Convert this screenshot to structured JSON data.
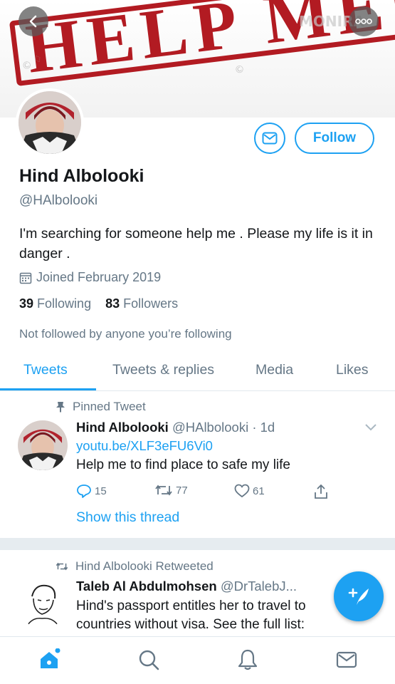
{
  "banner": {
    "stamp_text": "HELP ME!",
    "watermark_brand": "MONIRA"
  },
  "profile": {
    "name": "Hind Albolooki",
    "handle": "@HAlbolooki",
    "bio": "I'm searching for someone help me . Please my life is it in danger .",
    "joined": "Joined February 2019",
    "following_count": "39",
    "following_label": "Following",
    "followers_count": "83",
    "followers_label": "Followers",
    "not_followed": "Not followed by anyone you’re following",
    "follow_label": "Follow"
  },
  "tabs": [
    {
      "label": "Tweets",
      "active": true
    },
    {
      "label": "Tweets & replies",
      "active": false
    },
    {
      "label": "Media",
      "active": false
    },
    {
      "label": "Likes",
      "active": false
    }
  ],
  "pinned_tweet": {
    "pinned_label": "Pinned Tweet",
    "author": "Hind Albolooki",
    "handle_time": "@HAlbolooki · 1d",
    "link": "youtu.be/XLF3eFU6Vi0",
    "text": "Help me to find place to safe my life",
    "replies": "15",
    "retweets": "77",
    "likes": "61",
    "show_thread": "Show this thread"
  },
  "retweet": {
    "label": "Hind Albolooki Retweeted",
    "author": "Taleb Al Abdulmohsen",
    "handle": "@DrTalebJ...",
    "line1": "Hind's passport entitles her to travel to",
    "line2": "countries without visa. See the full list:"
  },
  "colors": {
    "accent": "#1da1f2",
    "stamp": "#b21b22",
    "muted": "#657786"
  },
  "icons": [
    "back-arrow-icon",
    "more-icon",
    "mail-icon",
    "calendar-icon",
    "pin-icon",
    "reply-icon",
    "retweet-icon",
    "like-icon",
    "share-icon",
    "chevron-down-icon",
    "compose-icon",
    "home-icon",
    "search-icon",
    "notifications-icon",
    "messages-icon"
  ]
}
